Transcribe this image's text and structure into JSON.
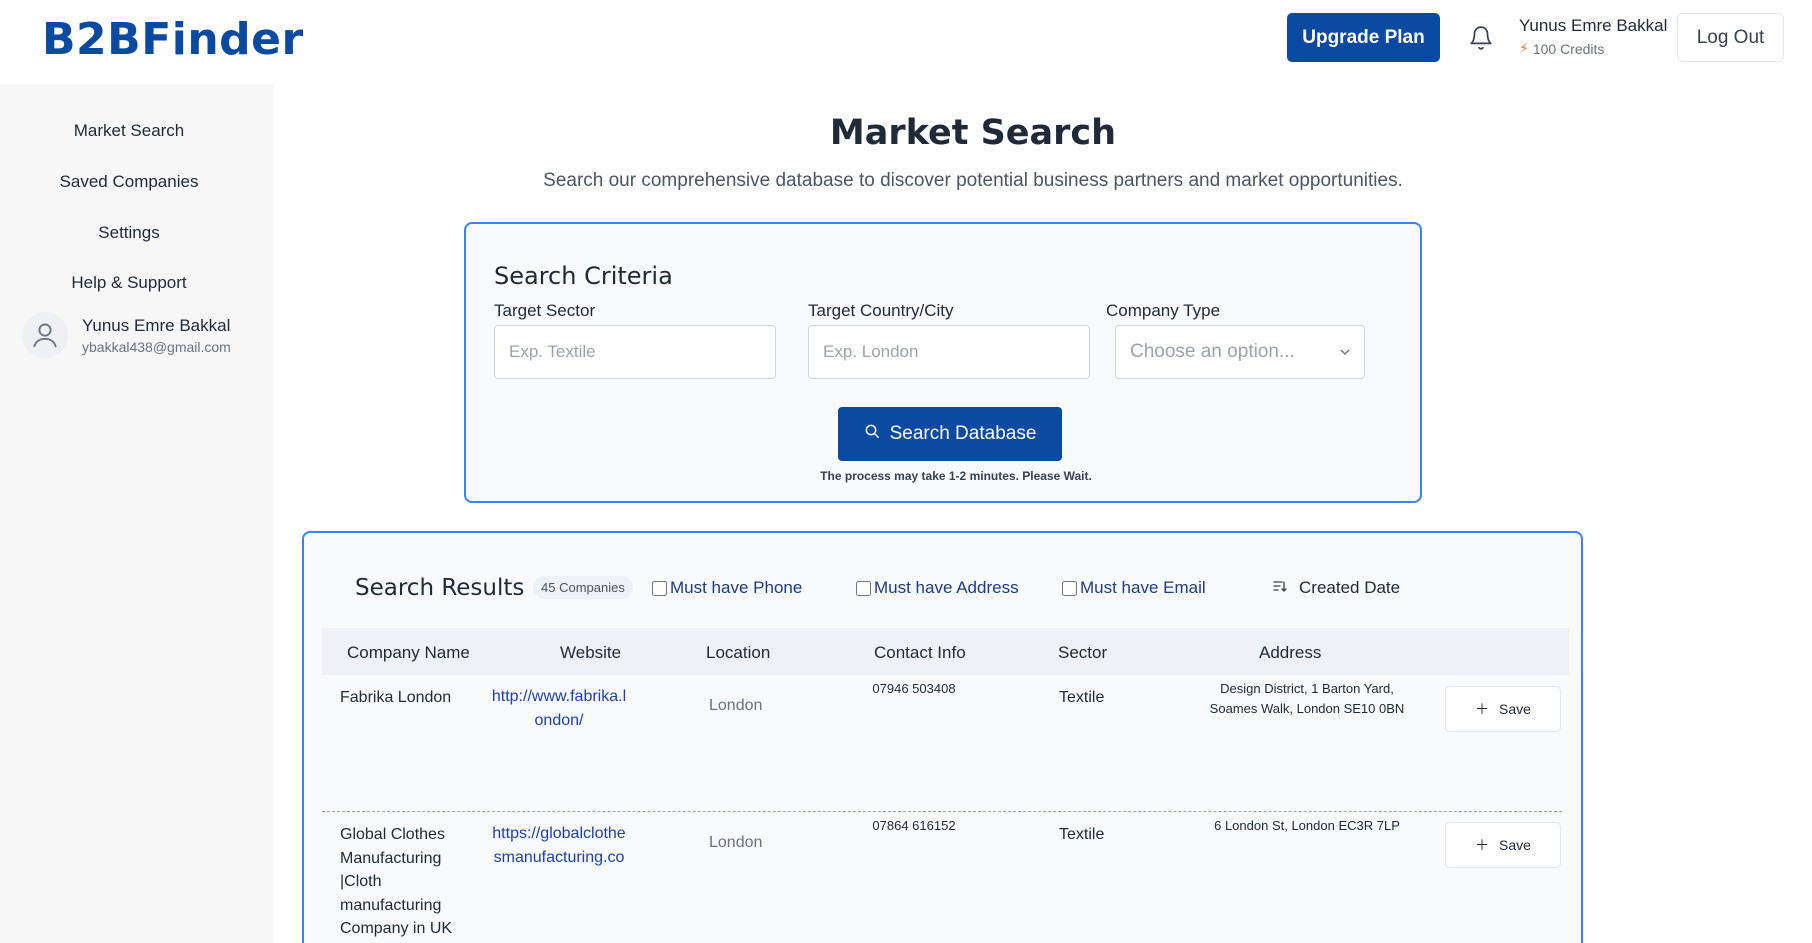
{
  "header": {
    "logo": "B2BFinder",
    "upgrade_label": "Upgrade Plan",
    "user_name": "Yunus Emre Bakkal",
    "credits": "100 Credits",
    "logout_label": "Log Out"
  },
  "sidebar": {
    "items": [
      {
        "label": "Market Search"
      },
      {
        "label": "Saved Companies"
      },
      {
        "label": "Settings"
      },
      {
        "label": "Help & Support"
      }
    ],
    "user": {
      "name": "Yunus Emre Bakkal",
      "email": "ybakkal438@gmail.com"
    }
  },
  "page": {
    "title": "Market Search",
    "subtitle": "Search our comprehensive database to discover potential business partners and market opportunities."
  },
  "criteria": {
    "title": "Search Criteria",
    "sector_label": "Target Sector",
    "sector_placeholder": "Exp. Textile",
    "country_label": "Target Country/City",
    "country_placeholder": "Exp. London",
    "type_label": "Company Type",
    "type_value": "Choose an option...",
    "search_label": "Search Database",
    "wait_note": "The process may take 1-2 minutes. Please Wait."
  },
  "results": {
    "title": "Search Results",
    "count": "45 Companies",
    "filters": {
      "phone": "Must have Phone",
      "address": "Must have Address",
      "email": "Must have Email"
    },
    "sort_label": "Created Date",
    "columns": {
      "name": "Company Name",
      "website": "Website",
      "location": "Location",
      "contact": "Contact Info",
      "sector": "Sector",
      "address": "Address"
    },
    "rows": [
      {
        "name": "Fabrika London",
        "website_l1": "http://www.fabrika.l",
        "website_l2": "ondon/",
        "location": "London",
        "contact": "07946 503408",
        "sector": "Textile",
        "address_l1": "Design District, 1 Barton Yard,",
        "address_l2": "Soames Walk, London SE10 0BN",
        "save_label": "Save"
      },
      {
        "name_l1": "Global Clothes",
        "name_l2": "Manufacturing",
        "name_l3": "|Cloth",
        "name_l4": "manufacturing",
        "name_l5": "Company in UK",
        "website_l1": "https://globalclothe",
        "website_l2": "smanufacturing.co",
        "location": "London",
        "contact": "07864 616152",
        "sector": "Textile",
        "address_l1": "6 London St, London EC3R 7LP",
        "save_label": "Save"
      }
    ]
  }
}
